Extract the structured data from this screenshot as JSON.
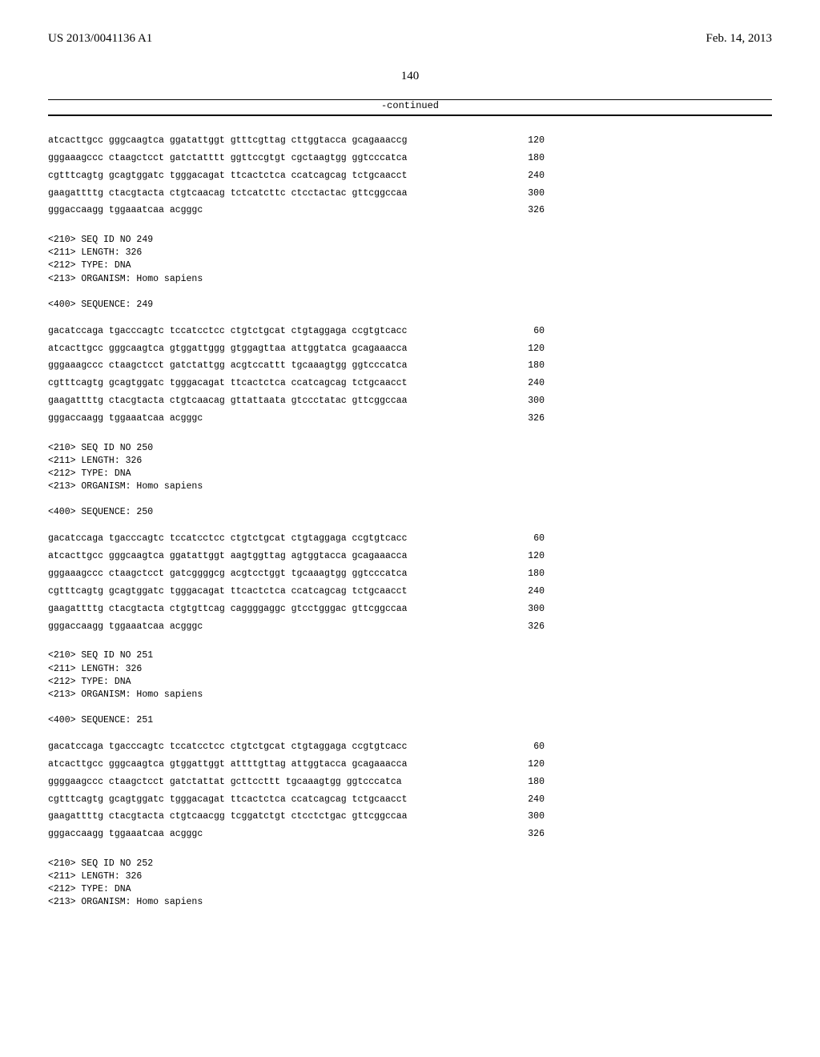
{
  "header": {
    "left": "US 2013/0041136 A1",
    "right": "Feb. 14, 2013"
  },
  "page_number": "140",
  "continued": "-continued",
  "block1": {
    "lines": [
      {
        "seq": "atcacttgcc gggcaagtca ggatattggt gtttcgttag cttggtacca gcagaaaccg",
        "num": "120"
      },
      {
        "seq": "gggaaagccc ctaagctcct gatctatttt ggttccgtgt cgctaagtgg ggtcccatca",
        "num": "180"
      },
      {
        "seq": "cgtttcagtg gcagtggatc tgggacagat ttcactctca ccatcagcag tctgcaacct",
        "num": "240"
      },
      {
        "seq": "gaagattttg ctacgtacta ctgtcaacag tctcatcttc ctcctactac gttcggccaa",
        "num": "300"
      },
      {
        "seq": "gggaccaagg tggaaatcaa acgggc",
        "num": "326"
      }
    ]
  },
  "meta249": "<210> SEQ ID NO 249\n<211> LENGTH: 326\n<212> TYPE: DNA\n<213> ORGANISM: Homo sapiens\n\n<400> SEQUENCE: 249",
  "block249": {
    "lines": [
      {
        "seq": "gacatccaga tgacccagtc tccatcctcc ctgtctgcat ctgtaggaga ccgtgtcacc",
        "num": "60"
      },
      {
        "seq": "atcacttgcc gggcaagtca gtggattggg gtggagttaa attggtatca gcagaaacca",
        "num": "120"
      },
      {
        "seq": "gggaaagccc ctaagctcct gatctattgg acgtccattt tgcaaagtgg ggtcccatca",
        "num": "180"
      },
      {
        "seq": "cgtttcagtg gcagtggatc tgggacagat ttcactctca ccatcagcag tctgcaacct",
        "num": "240"
      },
      {
        "seq": "gaagattttg ctacgtacta ctgtcaacag gttattaata gtccctatac gttcggccaa",
        "num": "300"
      },
      {
        "seq": "gggaccaagg tggaaatcaa acgggc",
        "num": "326"
      }
    ]
  },
  "meta250": "<210> SEQ ID NO 250\n<211> LENGTH: 326\n<212> TYPE: DNA\n<213> ORGANISM: Homo sapiens\n\n<400> SEQUENCE: 250",
  "block250": {
    "lines": [
      {
        "seq": "gacatccaga tgacccagtc tccatcctcc ctgtctgcat ctgtaggaga ccgtgtcacc",
        "num": "60"
      },
      {
        "seq": "atcacttgcc gggcaagtca ggatattggt aagtggttag agtggtacca gcagaaacca",
        "num": "120"
      },
      {
        "seq": "gggaaagccc ctaagctcct gatcggggcg acgtcctggt tgcaaagtgg ggtcccatca",
        "num": "180"
      },
      {
        "seq": "cgtttcagtg gcagtggatc tgggacagat ttcactctca ccatcagcag tctgcaacct",
        "num": "240"
      },
      {
        "seq": "gaagattttg ctacgtacta ctgtgttcag caggggaggc gtcctgggac gttcggccaa",
        "num": "300"
      },
      {
        "seq": "gggaccaagg tggaaatcaa acgggc",
        "num": "326"
      }
    ]
  },
  "meta251": "<210> SEQ ID NO 251\n<211> LENGTH: 326\n<212> TYPE: DNA\n<213> ORGANISM: Homo sapiens\n\n<400> SEQUENCE: 251",
  "block251": {
    "lines": [
      {
        "seq": "gacatccaga tgacccagtc tccatcctcc ctgtctgcat ctgtaggaga ccgtgtcacc",
        "num": "60"
      },
      {
        "seq": "atcacttgcc gggcaagtca gtggattggt attttgttag attggtacca gcagaaacca",
        "num": "120"
      },
      {
        "seq": "ggggaagccc ctaagctcct gatctattat gcttccttt tgcaaagtgg ggtcccatca",
        "num": "180"
      },
      {
        "seq": "cgtttcagtg gcagtggatc tgggacagat ttcactctca ccatcagcag tctgcaacct",
        "num": "240"
      },
      {
        "seq": "gaagattttg ctacgtacta ctgtcaacgg tcggatctgt ctcctctgac gttcggccaa",
        "num": "300"
      },
      {
        "seq": "gggaccaagg tggaaatcaa acgggc",
        "num": "326"
      }
    ]
  },
  "meta252": "<210> SEQ ID NO 252\n<211> LENGTH: 326\n<212> TYPE: DNA\n<213> ORGANISM: Homo sapiens"
}
